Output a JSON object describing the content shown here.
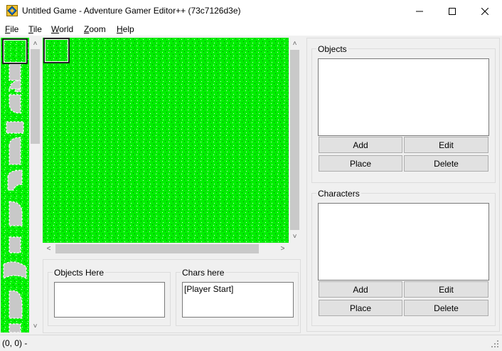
{
  "window": {
    "title": "Untitled Game - Adventure Gamer Editor++ (73c7126d3e)",
    "icon": "app-diamond-icon",
    "controls": [
      "minimize-icon",
      "maximize-icon",
      "close-icon"
    ]
  },
  "menubar": {
    "items": [
      {
        "mnemonic": "F",
        "rest": "ile"
      },
      {
        "mnemonic": "T",
        "rest": "ile"
      },
      {
        "mnemonic": "W",
        "rest": "orld"
      },
      {
        "mnemonic": "Z",
        "rest": "oom"
      },
      {
        "mnemonic": "H",
        "rest": "elp"
      }
    ]
  },
  "objects_panel": {
    "label": "Objects",
    "buttons": {
      "add": "Add",
      "edit": "Edit",
      "place": "Place",
      "delete": "Delete"
    }
  },
  "characters_panel": {
    "label": "Characters",
    "buttons": {
      "add": "Add",
      "edit": "Edit",
      "place": "Place",
      "delete": "Delete"
    }
  },
  "objects_here": {
    "label": "Objects Here",
    "items": []
  },
  "chars_here": {
    "label": "Chars here",
    "items": [
      "[Player Start]"
    ]
  },
  "statusbar": {
    "text": "(0, 0) -"
  },
  "colors": {
    "grass": "#00ff00",
    "road": "#c8c8c8",
    "chrome": "#f0f0f0"
  }
}
